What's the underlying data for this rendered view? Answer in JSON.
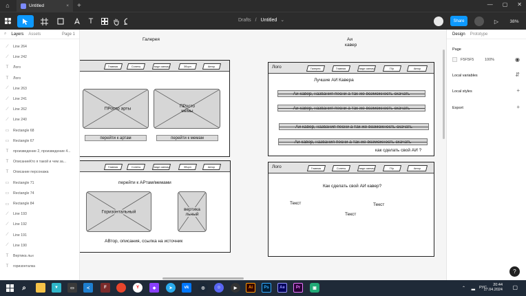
{
  "tab": {
    "title": "Untitled",
    "close": "×",
    "new": "+"
  },
  "window": {
    "minimize": "—",
    "maximize": "▢",
    "close": "✕"
  },
  "toolbar": {
    "drafts": "Drafts",
    "separator": "/",
    "file": "Untitled",
    "chevron": "⌄",
    "share": "Share",
    "zoom": "38%"
  },
  "left_panel": {
    "tabs": [
      "Layers",
      "Assets"
    ],
    "page": "Page 1",
    "layers": [
      {
        "icon": "line",
        "name": "Line 264"
      },
      {
        "icon": "line",
        "name": "Line 242"
      },
      {
        "icon": "text",
        "name": "Лого"
      },
      {
        "icon": "text",
        "name": "Лого"
      },
      {
        "icon": "line",
        "name": "Line 263"
      },
      {
        "icon": "line",
        "name": "Line 241"
      },
      {
        "icon": "line",
        "name": "Line 262"
      },
      {
        "icon": "line",
        "name": "Line 240"
      },
      {
        "icon": "rect",
        "name": "Rectangle 68"
      },
      {
        "icon": "rect",
        "name": "Rectangle 67"
      },
      {
        "icon": "text",
        "name": "произведение 2, произведение 4..."
      },
      {
        "icon": "text",
        "name": "ОписаниеКто я такой и чем за..."
      },
      {
        "icon": "text",
        "name": "Описание персонажа"
      },
      {
        "icon": "rect",
        "name": "Rectangle 71"
      },
      {
        "icon": "rect",
        "name": "Rectangle 74"
      },
      {
        "icon": "rect",
        "name": "Rectangle 84"
      },
      {
        "icon": "line",
        "name": "Line 193"
      },
      {
        "icon": "line",
        "name": "Line 192"
      },
      {
        "icon": "line",
        "name": "Line 191"
      },
      {
        "icon": "line",
        "name": "Line 190"
      },
      {
        "icon": "text",
        "name": "Вертика льн"
      },
      {
        "icon": "text",
        "name": "горизонталка"
      }
    ]
  },
  "canvas": {
    "label_gallery": "Галерея",
    "label_ai_line1": "Аи",
    "label_ai_line2": "кавер",
    "nav": [
      "Главная",
      "Сонеты",
      "виде омемы",
      "Зборн",
      "Автор"
    ],
    "logo": "Лого",
    "gallery_frame": {
      "card1": "ПРосто арты",
      "card2": "ПРосто мемы",
      "btn1": "перейти к артам",
      "btn2": "перейти к мемам"
    },
    "bottom_left_frame": {
      "heading": "перейти к АРтам/мемами",
      "horizontal": "Горизонтальный",
      "vertical": "вертика льный",
      "footer": "АВтор, описания, ссылка на источник"
    },
    "ai_frame": {
      "nav": [
        "Галерея",
        "Главная",
        "виде омемы",
        "Г0р",
        "Автор"
      ],
      "title": "Лучшие АИ Кавера",
      "rows": [
        "Аи кавер, названия песни  а так же возможность скачать",
        "Аи кавер, названия песни  а так же возможность скачать",
        "Аи кавер, названия песни  а так же возможность скачать",
        "Аи кавер, названия песни  а так же возможность скачать"
      ],
      "footer": "как сделать свой АИ ?"
    },
    "how_frame": {
      "nav": [
        "Главная",
        "Сонеты",
        "виде омемы",
        "Г0р",
        "Автор"
      ],
      "title": "Как сделать свой АИ кавер?",
      "t1": "Текст",
      "t2": "Текст",
      "t3": "Текст"
    }
  },
  "right_panel": {
    "tabs": [
      "Design",
      "Prototype"
    ],
    "page_label": "Page",
    "page_color": "F5F5F5",
    "page_opacity": "100%",
    "local_variables": "Local variables",
    "local_styles": "Local styles",
    "export": "Export"
  },
  "taskbar": {
    "lang": "РУС",
    "time": "20:44",
    "date": "17.04.2024"
  },
  "help": "?"
}
